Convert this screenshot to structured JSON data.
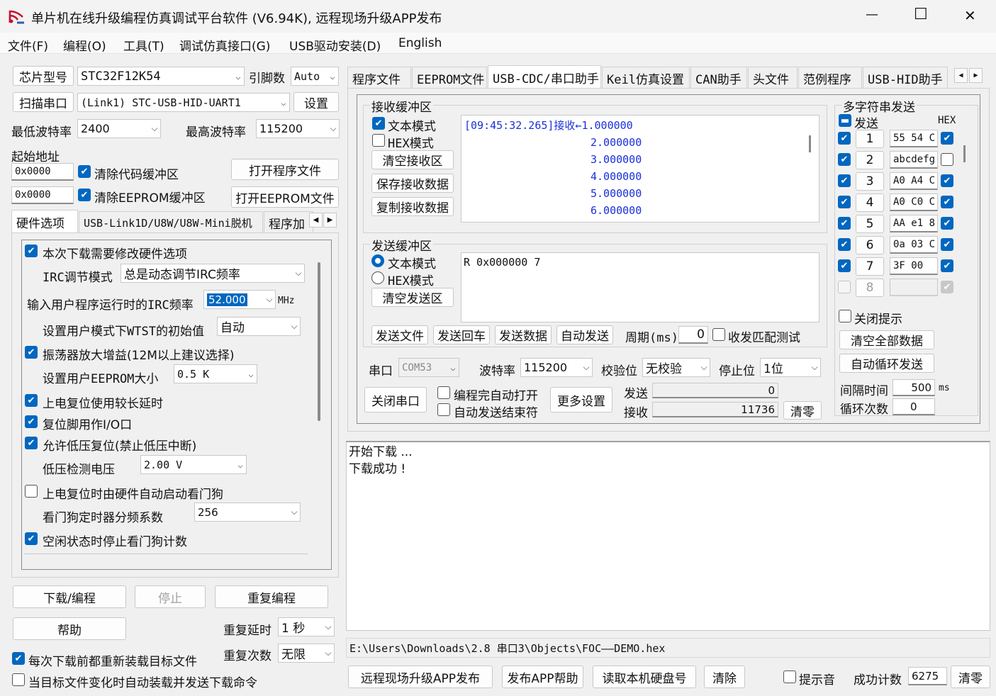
{
  "window": {
    "title": "单片机在线升级编程仿真调试平台软件 (V6.94K), 远程现场升级APP发布",
    "min": "—",
    "max": "☐",
    "close": "✕"
  },
  "menu": [
    "文件(F)",
    "编程(O)",
    "工具(T)",
    "调试仿真接口(G)",
    "USB驱动安装(D)",
    "English"
  ],
  "left": {
    "chip_btn": "芯片型号",
    "chip_value": "STC32F12K54",
    "pins_label": "引脚数",
    "pins_value": "Auto",
    "scan_btn": "扫描串口",
    "port_value": "(Link1) STC-USB-HID-UART1",
    "settings_btn": "设置",
    "min_baud_label": "最低波特率",
    "min_baud_value": "2400",
    "max_baud_label": "最高波特率",
    "max_baud_value": "115200",
    "start_addr_label": "起始地址",
    "addr1": "0x0000",
    "clear_code": "清除代码缓冲区",
    "open_prog": "打开程序文件",
    "addr2": "0x0000",
    "clear_eeprom": "清除EEPROM缓冲区",
    "open_eeprom": "打开EEPROM文件",
    "tabs": [
      "硬件选项",
      "USB-Link1D/U8W/U8W-Mini脱机",
      "程序加"
    ],
    "hw": {
      "opt_modify": "本次下载需要修改硬件选项",
      "irc_mode_label": "IRC调节模式",
      "irc_mode_value": "总是动态调节IRC频率",
      "irc_freq_label": "输入用户程序运行时的IRC频率",
      "irc_freq_value": "52.000",
      "mhz": "MHz",
      "wtst_label": "设置用户模式下WTST的初始值",
      "wtst_value": "自动",
      "osc_gain": "振荡器放大增益(12M以上建议选择)",
      "eeprom_size_label": "设置用户EEPROM大小",
      "eeprom_size_value": "0.5 K",
      "long_delay": "上电复位使用较长延时",
      "reset_io": "复位脚用作I/O口",
      "lvr": "允许低压复位(禁止低压中断)",
      "lvd_label": "低压检测电压",
      "lvd_value": "2.00 V",
      "wdt_auto": "上电复位时由硬件自动启动看门狗",
      "wdt_div_label": "看门狗定时器分频系数",
      "wdt_div_value": "256",
      "idle_wdt": "空闲状态时停止看门狗计数"
    },
    "download_btn": "下载/编程",
    "stop_btn": "停止",
    "redo_btn": "重复编程",
    "help_btn": "帮助",
    "redo_delay_label": "重复延时",
    "redo_delay_value": "1 秒",
    "redo_count_label": "重复次数",
    "redo_count_value": "无限",
    "reload_each": "每次下载前都重新装载目标文件",
    "auto_reload": "当目标文件变化时自动装载并发送下载命令"
  },
  "right": {
    "tabs": [
      "程序文件",
      "EEPROM文件",
      "USB-CDC/串口助手",
      "Keil仿真设置",
      "CAN助手",
      "头文件",
      "范例程序",
      "USB-HID助手"
    ],
    "recv": {
      "title": "接收缓冲区",
      "text_mode": "文本模式",
      "hex_mode": "HEX模式",
      "clear": "清空接收区",
      "save": "保存接收数据",
      "copy": "复制接收数据",
      "lines": [
        "[09:45:32.265]接收←1.000000",
        "2.000000",
        "3.000000",
        "4.000000",
        "5.000000",
        "6.000000"
      ]
    },
    "send": {
      "title": "发送缓冲区",
      "text_mode": "文本模式",
      "hex_mode": "HEX模式",
      "clear": "清空发送区",
      "content": "R 0x000000 7",
      "send_file": "发送文件",
      "send_cr": "发送回车",
      "send_data": "发送数据",
      "auto_send": "自动发送",
      "period_label": "周期(ms)",
      "period_value": "0",
      "match_test": "收发匹配测试"
    },
    "serial": {
      "port_label": "串口",
      "port_value": "COM53",
      "baud_label": "波特率",
      "baud_value": "115200",
      "parity_label": "校验位",
      "parity_value": "无校验",
      "stop_label": "停止位",
      "stop_value": "1位",
      "close_btn": "关闭串口",
      "auto_open": "编程完自动打开",
      "auto_end": "自动发送结束符",
      "more_btn": "更多设置",
      "send_label": "发送",
      "send_count": "0",
      "recv_label": "接收",
      "recv_count": "11736",
      "zero_btn": "清零"
    },
    "multi": {
      "title": "多字符串发送",
      "send_hdr": "发送",
      "hex_hdr": "HEX",
      "rows": [
        {
          "n": "1",
          "v": "55 54 C"
        },
        {
          "n": "2",
          "v": "abcdefg"
        },
        {
          "n": "3",
          "v": "A0 A4 C"
        },
        {
          "n": "4",
          "v": "A0 C0 C"
        },
        {
          "n": "5",
          "v": "AA e1 8"
        },
        {
          "n": "6",
          "v": "0a 03 C"
        },
        {
          "n": "7",
          "v": "3F 00"
        },
        {
          "n": "8",
          "v": ""
        }
      ],
      "close_tip": "关闭提示",
      "clear_all": "清空全部数据",
      "auto_loop": "自动循环发送",
      "interval_label": "间隔时间",
      "interval_value": "500",
      "ms": "ms",
      "loop_label": "循环次数",
      "loop_value": "0"
    },
    "log": [
      "开始下载 ...",
      "下载成功 !"
    ],
    "path": "E:\\Users\\Downloads\\2.8 串口3\\Objects\\FOC——DEMO.hex",
    "bottom": {
      "remote_btn": "远程现场升级APP发布",
      "app_help": "发布APP帮助",
      "read_disk": "读取本机硬盘号",
      "clear_btn": "清除",
      "tip_sound": "提示音",
      "success_label": "成功计数",
      "success_value": "6275",
      "zero_btn": "清零"
    }
  },
  "colors": {
    "accent": "#0067c0",
    "log_blue": "#1a30d8"
  }
}
